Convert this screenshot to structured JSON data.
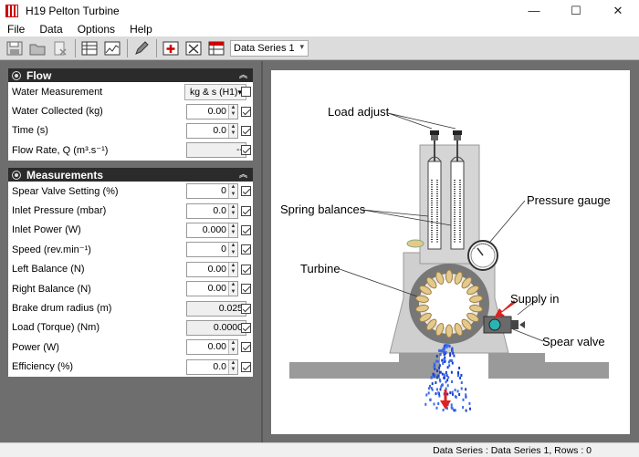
{
  "window": {
    "title": "H19 Pelton Turbine",
    "controls": [
      "—",
      "☐",
      "✕"
    ]
  },
  "menu": [
    "File",
    "Data",
    "Options",
    "Help"
  ],
  "toolbar": {
    "series_select": "Data Series 1"
  },
  "flow": {
    "title": "Flow",
    "rows": [
      {
        "label": "Water Measurement",
        "value": "kg & s (H1)",
        "kind": "dropdown",
        "checked": false
      },
      {
        "label": "Water Collected (kg)",
        "value": "0.00",
        "kind": "spin",
        "checked": true
      },
      {
        "label": "Time  (s)",
        "value": "0.0",
        "kind": "spin",
        "checked": true
      },
      {
        "label": "Flow Rate, Q  (m³.s⁻¹)",
        "value": "--",
        "kind": "readonly",
        "checked": true
      }
    ]
  },
  "measurements": {
    "title": "Measurements",
    "rows": [
      {
        "label": "Spear Valve Setting (%)",
        "value": "0",
        "kind": "spin",
        "checked": true
      },
      {
        "label": "Inlet Pressure  (mbar)",
        "value": "0.0",
        "kind": "spin",
        "checked": true
      },
      {
        "label": "Inlet Power  (W)",
        "value": "0.000",
        "kind": "spin",
        "checked": true
      },
      {
        "label": "Speed  (rev.min⁻¹)",
        "value": "0",
        "kind": "spin",
        "checked": true
      },
      {
        "label": "Left Balance  (N)",
        "value": "0.00",
        "kind": "spin",
        "checked": true
      },
      {
        "label": "Right Balance  (N)",
        "value": "0.00",
        "kind": "spin",
        "checked": true
      },
      {
        "label": "Brake drum radius  (m)",
        "value": "0.025",
        "kind": "readonly",
        "checked": true
      },
      {
        "label": "Load (Torque)  (Nm)",
        "value": "0.0000",
        "kind": "readonly",
        "checked": true
      },
      {
        "label": "Power  (W)",
        "value": "0.00",
        "kind": "spin",
        "checked": true
      },
      {
        "label": "Efficiency  (%)",
        "value": "0.0",
        "kind": "spin",
        "checked": true
      }
    ]
  },
  "diagram": {
    "labels": {
      "load_adjust": "Load adjust",
      "spring_balances": "Spring balances",
      "pressure_gauge": "Pressure gauge",
      "turbine": "Turbine",
      "supply_in": "Supply in",
      "spear_valve": "Spear valve"
    }
  },
  "status": {
    "text": "Data Series : Data Series 1,  Rows : 0"
  }
}
